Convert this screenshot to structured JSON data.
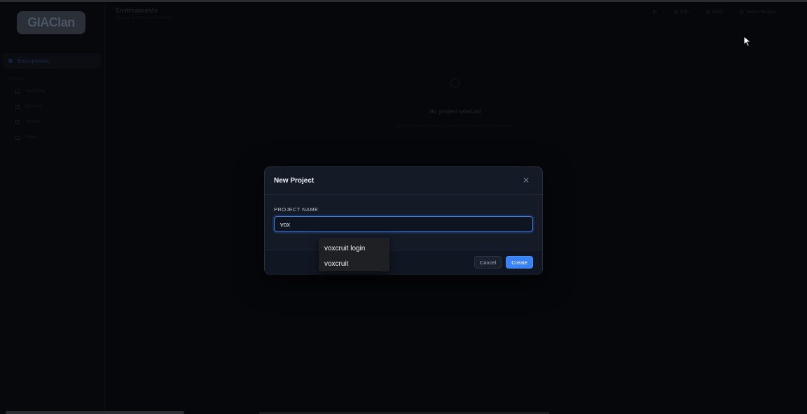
{
  "sidebar": {
    "logo_text": "GIAClan",
    "active_item": "Environment",
    "section_label": "Settings",
    "items": [
      {
        "label": "Variables",
        "icon": "variables-icon"
      },
      {
        "label": "Secrets",
        "icon": "secrets-icon"
      },
      {
        "label": "Tokens",
        "icon": "tokens-icon"
      },
      {
        "label": "Plans",
        "icon": "plans-icon"
      }
    ]
  },
  "header": {
    "title": "Environments",
    "subtitle": "Manage environment variables",
    "buttons": [
      {
        "label": "Edit"
      },
      {
        "label": "Push"
      },
      {
        "label": "Select Project"
      }
    ]
  },
  "empty_state": {
    "title": "No project selected",
    "subtitle": "Select a project or create a new one to manage its environment"
  },
  "modal": {
    "title": "New Project",
    "close_icon": "close-icon",
    "field_label": "PROJECT NAME",
    "input_value": "vox",
    "cancel_label": "Cancel",
    "create_label": "Create"
  },
  "autocomplete": {
    "items": [
      "voxcruit login",
      "voxcruit"
    ]
  },
  "colors": {
    "accent": "#3b82f6",
    "modal_bg": "#141b27",
    "page_bg": "#06070a"
  }
}
